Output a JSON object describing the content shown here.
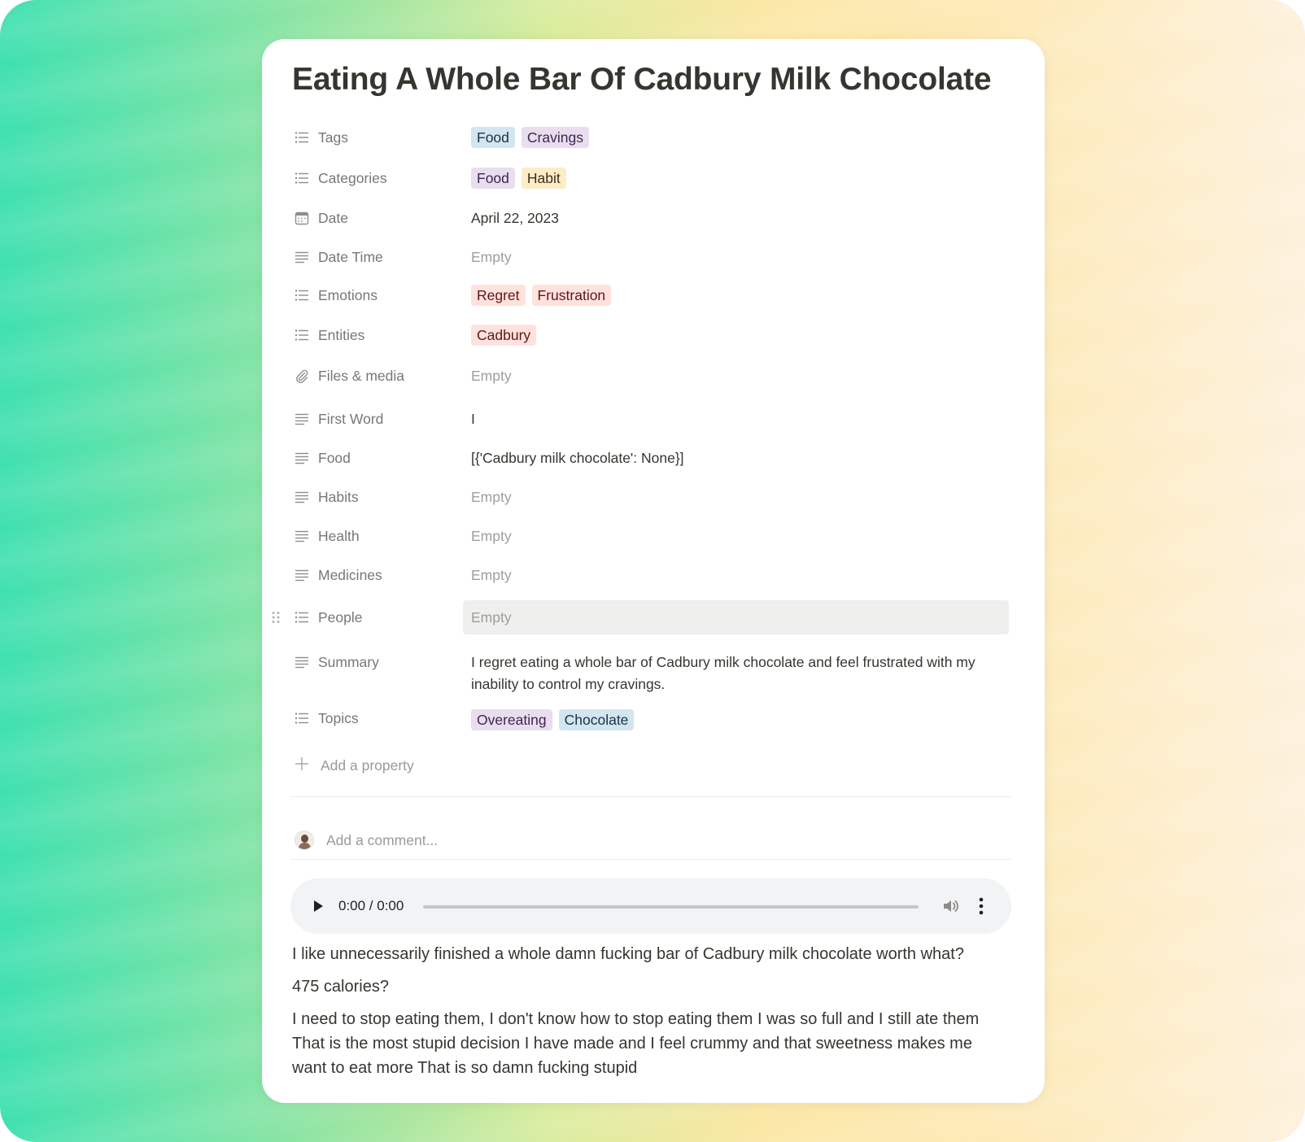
{
  "page": {
    "title": "Eating A Whole Bar Of Cadbury Milk Chocolate"
  },
  "properties": [
    {
      "label": "Tags",
      "icon": "list-icon",
      "tags": [
        {
          "text": "Food",
          "bg": "#d3e5ef",
          "fg": "#183347"
        },
        {
          "text": "Cravings",
          "bg": "#e8deee",
          "fg": "#412454"
        }
      ]
    },
    {
      "label": "Categories",
      "icon": "list-icon",
      "tags": [
        {
          "text": "Food",
          "bg": "#e8deee",
          "fg": "#412454"
        },
        {
          "text": "Habit",
          "bg": "#fdecc8",
          "fg": "#402c1b"
        }
      ]
    },
    {
      "label": "Date",
      "icon": "calendar-icon",
      "value": "April 22, 2023"
    },
    {
      "label": "Date Time",
      "icon": "text-icon",
      "value": "Empty",
      "empty": true
    },
    {
      "label": "Emotions",
      "icon": "list-icon",
      "tags": [
        {
          "text": "Regret",
          "bg": "#ffe2dd",
          "fg": "#5d1715"
        },
        {
          "text": "Frustration",
          "bg": "#ffe2dd",
          "fg": "#5d1715"
        }
      ]
    },
    {
      "label": "Entities",
      "icon": "list-icon",
      "tags": [
        {
          "text": "Cadbury",
          "bg": "#ffe2dd",
          "fg": "#5d1715"
        }
      ]
    },
    {
      "label": "Files & media",
      "icon": "paperclip-icon",
      "value": "Empty",
      "empty": true
    },
    {
      "label": "First Word",
      "icon": "text-icon",
      "value": "I"
    },
    {
      "label": "Food",
      "icon": "text-icon",
      "value": "[{'Cadbury milk chocolate': None}]"
    },
    {
      "label": "Habits",
      "icon": "text-icon",
      "value": "Empty",
      "empty": true
    },
    {
      "label": "Health",
      "icon": "text-icon",
      "value": "Empty",
      "empty": true
    },
    {
      "label": "Medicines",
      "icon": "text-icon",
      "value": "Empty",
      "empty": true
    },
    {
      "label": "People",
      "icon": "list-icon",
      "value": "Empty",
      "empty": true
    },
    {
      "label": "Summary",
      "icon": "text-icon",
      "value": "I regret eating a whole bar of Cadbury milk chocolate and feel frustrated with my inability to control my cravings."
    },
    {
      "label": "Topics",
      "icon": "list-icon",
      "tags": [
        {
          "text": "Overeating",
          "bg": "#e8deee",
          "fg": "#412454"
        },
        {
          "text": "Chocolate",
          "bg": "#d3e5ef",
          "fg": "#183347"
        }
      ]
    }
  ],
  "add_property_label": "Add a property",
  "comment": {
    "placeholder": "Add a comment..."
  },
  "audio": {
    "time": "0:00 / 0:00",
    "progress": 0
  },
  "transcript": [
    "I like unnecessarily finished a whole damn fucking bar of Cadbury milk chocolate worth what?",
    "475 calories?",
    "I need to stop eating them, I don't know how to stop eating them I was so full and I still ate them That is the most stupid decision I have made and I feel crummy and that sweetness makes me want to eat more That is so damn fucking stupid"
  ]
}
